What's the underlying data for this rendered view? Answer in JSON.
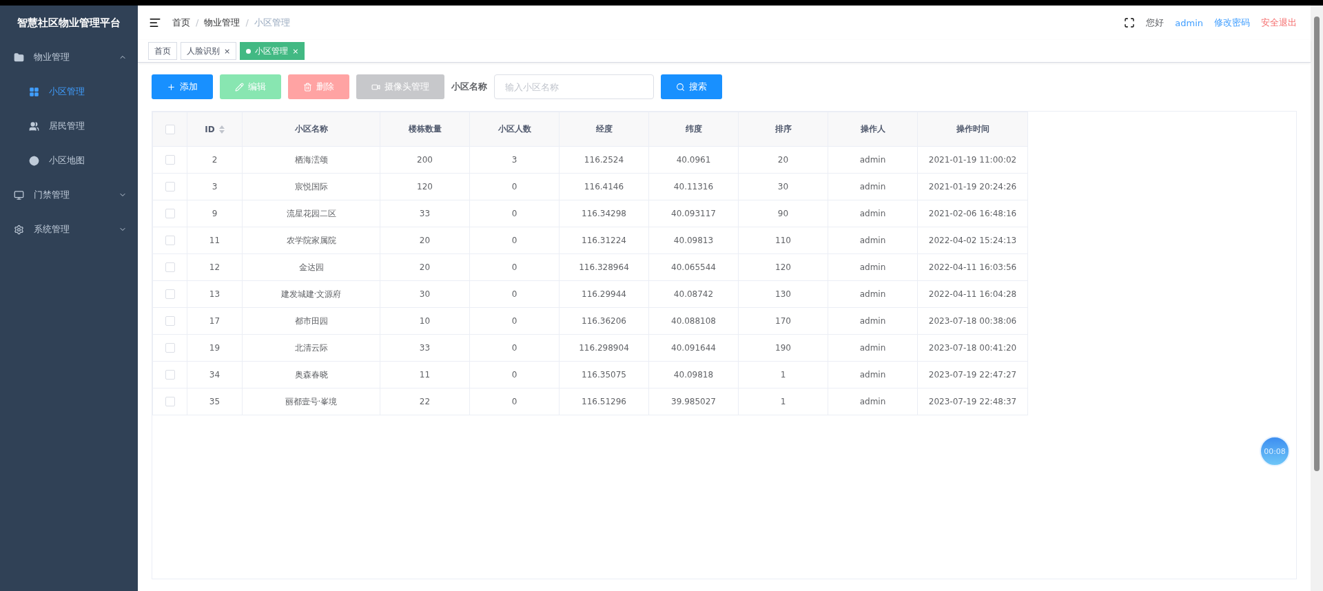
{
  "sidebar": {
    "title": "智慧社区物业管理平台",
    "items": [
      {
        "label": "物业管理",
        "expanded": true,
        "children": [
          {
            "label": "小区管理",
            "selected": true
          },
          {
            "label": "居民管理",
            "selected": false
          },
          {
            "label": "小区地图",
            "selected": false
          }
        ]
      },
      {
        "label": "门禁管理",
        "expanded": false
      },
      {
        "label": "系统管理",
        "expanded": false
      }
    ]
  },
  "breadcrumb": [
    "首页",
    "物业管理",
    "小区管理"
  ],
  "separator": "/",
  "user": {
    "greeting": "您好",
    "name": "admin",
    "change_password": "修改密码",
    "logout": "安全退出"
  },
  "tabs": [
    {
      "label": "首页",
      "closable": false,
      "selected": false
    },
    {
      "label": "人脸识别",
      "closable": true,
      "selected": false
    },
    {
      "label": "小区管理",
      "closable": true,
      "selected": true
    }
  ],
  "close_mark": "×",
  "toolbar": {
    "buttons": [
      {
        "label": "添加",
        "kind": "add",
        "disabled": false
      },
      {
        "label": "编辑",
        "kind": "edit",
        "disabled": true
      },
      {
        "label": "删除",
        "kind": "delete",
        "disabled": true
      },
      {
        "label": "摄像头管理",
        "kind": "camera",
        "disabled": true
      }
    ],
    "filter_label": "小区名称",
    "placeholder": "输入小区名称",
    "search": "搜索"
  },
  "table": {
    "select_all": {
      "checked": false
    },
    "columns": [
      "ID",
      "小区名称",
      "楼栋数量",
      "小区人数",
      "经度",
      "纬度",
      "排序",
      "操作人",
      "操作时间"
    ],
    "rows": [
      {
        "checked": false,
        "cells": [
          "2",
          "栖海澐颂",
          "200",
          "3",
          "116.2524",
          "40.0961",
          "20",
          "admin",
          "2021-01-19 11:00:02"
        ]
      },
      {
        "checked": false,
        "cells": [
          "3",
          "宸悦国际",
          "120",
          "0",
          "116.4146",
          "40.11316",
          "30",
          "admin",
          "2021-01-19 20:24:26"
        ]
      },
      {
        "checked": false,
        "cells": [
          "9",
          "流星花园二区",
          "33",
          "0",
          "116.34298",
          "40.093117",
          "90",
          "admin",
          "2021-02-06 16:48:16"
        ]
      },
      {
        "checked": false,
        "cells": [
          "11",
          "农学院家属院",
          "20",
          "0",
          "116.31224",
          "40.09813",
          "110",
          "admin",
          "2022-04-02 15:24:13"
        ]
      },
      {
        "checked": false,
        "cells": [
          "12",
          "金达园",
          "20",
          "0",
          "116.328964",
          "40.065544",
          "120",
          "admin",
          "2022-04-11 16:03:56"
        ]
      },
      {
        "checked": false,
        "cells": [
          "13",
          "建发城建·文源府",
          "30",
          "0",
          "116.29944",
          "40.08742",
          "130",
          "admin",
          "2022-04-11 16:04:28"
        ]
      },
      {
        "checked": false,
        "cells": [
          "17",
          "都市田园",
          "10",
          "0",
          "116.36206",
          "40.088108",
          "170",
          "admin",
          "2023-07-18 00:38:06"
        ]
      },
      {
        "checked": false,
        "cells": [
          "19",
          "北清云际",
          "33",
          "0",
          "116.298904",
          "40.091644",
          "190",
          "admin",
          "2023-07-18 00:41:20"
        ]
      },
      {
        "checked": false,
        "cells": [
          "34",
          "奥森春晓",
          "11",
          "0",
          "116.35075",
          "40.09818",
          "1",
          "admin",
          "2023-07-19 22:47:27"
        ]
      },
      {
        "checked": false,
        "cells": [
          "35",
          "丽都壹号·峯境",
          "22",
          "0",
          "116.51296",
          "39.985027",
          "1",
          "admin",
          "2023-07-19 22:48:37"
        ]
      }
    ]
  },
  "timer": "00:08"
}
